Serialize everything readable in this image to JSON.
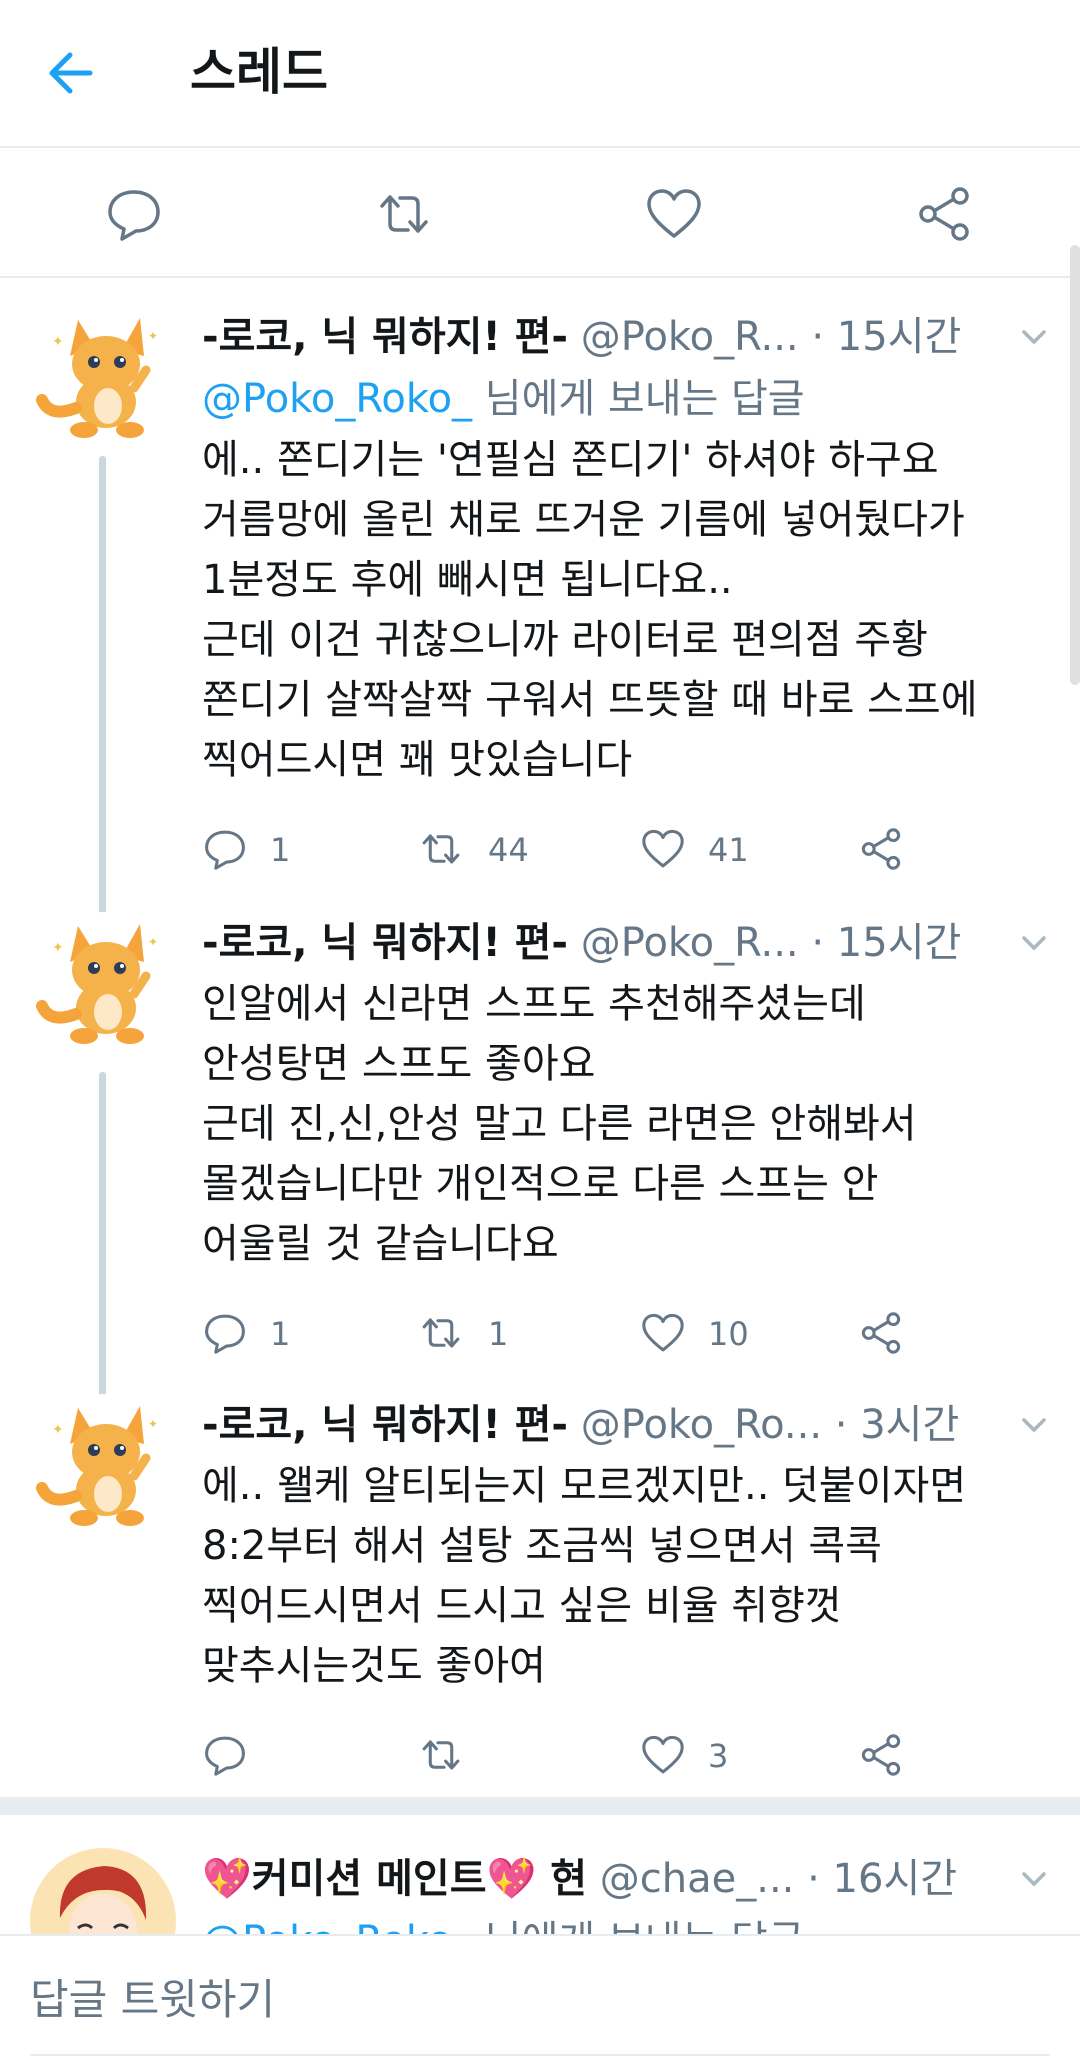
{
  "header": {
    "title": "스레드",
    "back_icon": "arrow-left-icon"
  },
  "accent_color": "#1da1f2",
  "action_bar": [
    "reply-icon",
    "retweet-icon",
    "like-icon",
    "share-icon"
  ],
  "tweets": [
    {
      "name": "-로코, 닉 뭐하지! 편-",
      "handle": "@Poko_R...",
      "dot": "·",
      "time": "15시간",
      "reply_to_mention": "@Poko_Roko_",
      "reply_to_suffix": " 님에게 보내는 답글",
      "text": "에.. 쫀디기는 '연필심 쫀디기' 하셔야 하구요\n거름망에 올린 채로 뜨거운 기름에 넣어뒀다가\n1분정도 후에 빼시면 됩니다요..\n근데 이건 귀찮으니까 라이터로 편의점 주황\n쫀디기 살짝살짝 구워서 뜨뜻할 때 바로 스프에\n찍어드시면 꽤 맛있습니다",
      "replies": "1",
      "retweets": "44",
      "likes": "41"
    },
    {
      "name": "-로코, 닉 뭐하지! 편-",
      "handle": "@Poko_R...",
      "dot": "·",
      "time": "15시간",
      "text": "인알에서 신라면 스프도 추천해주셨는데\n안성탕면 스프도 좋아요\n근데 진,신,안성 말고 다른 라면은 안해봐서\n몰겠습니다만 개인적으로 다른 스프는 안\n어울릴 것 같습니다요",
      "replies": "1",
      "retweets": "1",
      "likes": "10"
    },
    {
      "name": "-로코, 닉 뭐하지! 편-",
      "handle": "@Poko_Ro...",
      "dot": "·",
      "time": "3시간",
      "text": "에.. 왤케 알티되는지 모르겠지만.. 덧붙이자면\n8:2부터 해서 설탕 조금씩 넣으면서 콕콕\n찍어드시면서 드시고 싶은 비율 취향껏\n맞추시는것도 좋아여",
      "replies": "",
      "retweets": "",
      "likes": "3"
    },
    {
      "name": "💖커미션 메인트💖 현",
      "handle": "@chae_...",
      "dot": "·",
      "time": "16시간",
      "reply_to_mention": "@Poko_Roko_",
      "reply_to_suffix": " 님에게 보내는 답글"
    }
  ],
  "compose": {
    "placeholder": "답글 트윗하기"
  }
}
